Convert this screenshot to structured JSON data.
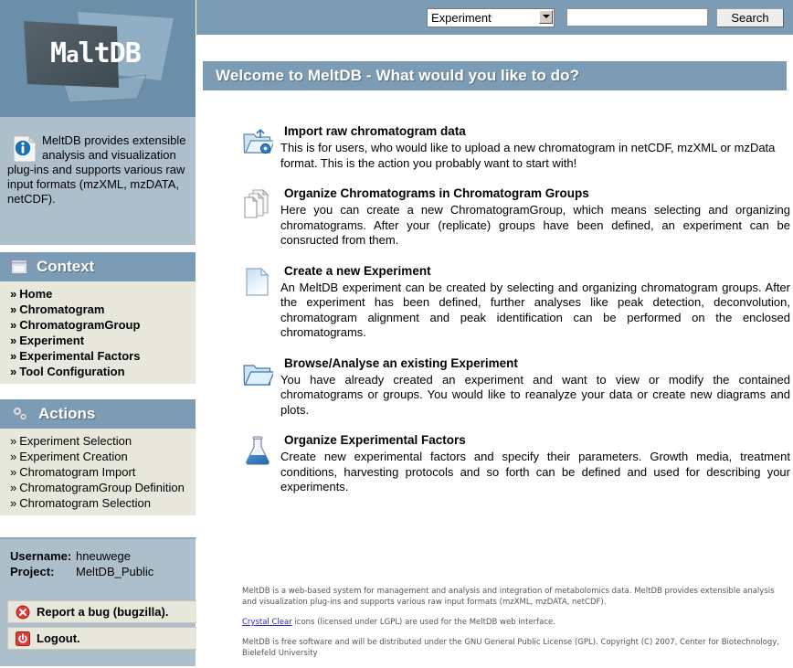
{
  "search": {
    "select_value": "Experiment",
    "select_options": [
      "Experiment"
    ],
    "input_value": "",
    "input_placeholder": "",
    "button_label": "Search",
    "dropdown_icon": "chevron-down-icon"
  },
  "logo": {
    "text": "MeltDB",
    "panel_color": "#6b8fa8"
  },
  "info": {
    "text": "MeltDB provides extensible analysis and visualization plug-ins and supports various raw input formats (mzXML, mzDATA, netCDF).",
    "icon": "info-page-icon"
  },
  "sidebar": {
    "context": {
      "title": "Context",
      "icon": "window-icon",
      "items": [
        {
          "label": "Home",
          "bullet": "»"
        },
        {
          "label": "Chromatogram",
          "bullet": "»"
        },
        {
          "label": "ChromatogramGroup",
          "bullet": "»"
        },
        {
          "label": "Experiment",
          "bullet": "»"
        },
        {
          "label": "Experimental Factors",
          "bullet": "»"
        },
        {
          "label": "Tool Configuration",
          "bullet": "»"
        }
      ]
    },
    "actions": {
      "title": "Actions",
      "icon": "gears-icon",
      "items": [
        {
          "label": "Experiment Selection",
          "bullet": "»"
        },
        {
          "label": "Experiment Creation",
          "bullet": "»"
        },
        {
          "label": "Chromatogram Import",
          "bullet": "»"
        },
        {
          "label": "ChromatogramGroup Definition",
          "bullet": "»"
        },
        {
          "label": "Chromatogram Selection",
          "bullet": "»"
        }
      ]
    }
  },
  "user": {
    "username_label": "Username:",
    "username_value": "hneuwege",
    "project_label": "Project:",
    "project_value": "MeltDB_Public",
    "bug_link": "Report a bug (bugzilla).",
    "bug_icon": "error-cross-icon",
    "logout_link": "Logout.",
    "logout_icon": "power-icon"
  },
  "main": {
    "welcome_title": "Welcome to MeltDB  - What would you like to do?",
    "sections": [
      {
        "icon": "folder-import-icon",
        "title": "Import raw chromatogram data",
        "body": "This is for users, who would like to upload a new chromatogram in netCDF, mzXML or mzData format. This is the action you probably want to start with!",
        "justify": false
      },
      {
        "icon": "documents-stack-icon",
        "title": "Organize Chromatograms in Chromatogram Groups",
        "body": "Here you can create a new ChromatogramGroup, which means selecting and organizing chromatograms. After your (replicate) groups have been defined, an experiment can be consructed from them.",
        "justify": true
      },
      {
        "icon": "blank-document-icon",
        "title": "Create a new Experiment",
        "body": "An MeltDB experiment can be created by selecting and organizing chromatogram groups. After the experiment has been defined, further analyses like peak detection, deconvolution, chromatogram alignment and peak identification can be performed on the enclosed chromatograms.",
        "justify": true
      },
      {
        "icon": "folder-open-icon",
        "title": "Browse/Analyse an existing Experiment",
        "body": "You have already created an experiment and want to view or modify the contained chromatograms or groups. You would like to reanalyze your data or create new diagrams and plots.",
        "justify": true
      },
      {
        "icon": "flask-icon",
        "title": "Organize Experimental Factors",
        "body": "Create new experimental factors and specify their parameters. Growth media, treatment conditions, harvesting protocols and so forth can be defined and used for describing your experiments.",
        "justify": true
      }
    ]
  },
  "footer": {
    "paragraph1": "MeltDB  is a web-based system for management and analysis and integration of metabolomics data. MeltDB provides extensible analysis and visualization plug-ins and supports various raw input formats (mzXML, mzDATA, netCDF).",
    "paragraph2_link": "Crystal Clear",
    "paragraph2_rest": " icons (licensed under LGPL) are used for the MeltDB web interface.",
    "paragraph3": "MeltDB  is free software and will be distributed under the GNU General Public License (GPL). Copyright (C) 2007, Center for Biotechnology, Bielefeld University"
  },
  "colors": {
    "accent": "#7b9cb4",
    "panel": "#aebfcc",
    "menu_bg": "#e8e7dc",
    "logo_bg": "#6b8fa8"
  }
}
